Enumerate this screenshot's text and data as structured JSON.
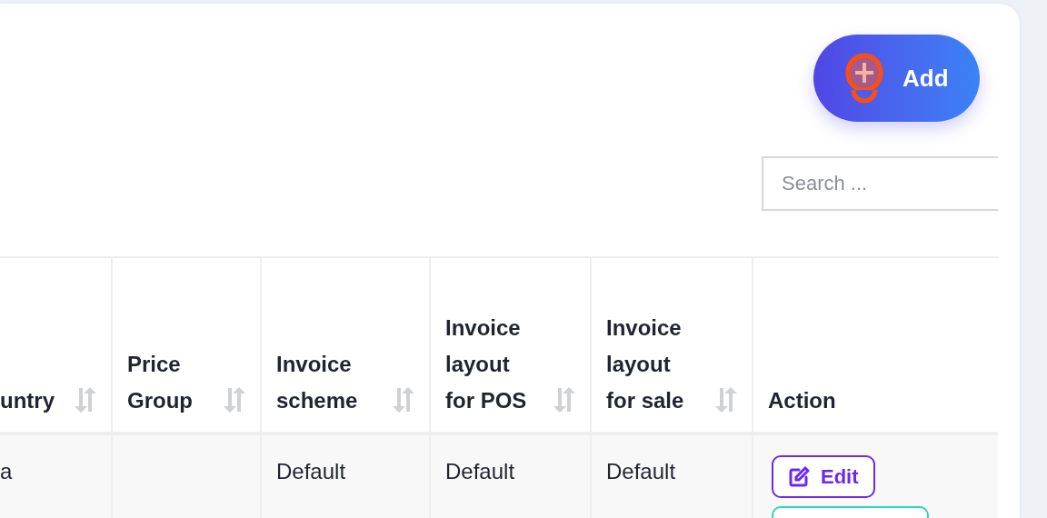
{
  "add_button": {
    "label": "Add"
  },
  "search": {
    "placeholder": "Search ..."
  },
  "table": {
    "columns": [
      {
        "label": "untry",
        "sortable": true
      },
      {
        "label": "Price Group",
        "sortable": true
      },
      {
        "label": "Invoice scheme",
        "sortable": true
      },
      {
        "label": "Invoice layout for POS",
        "sortable": true
      },
      {
        "label": "Invoice layout for sale",
        "sortable": true
      },
      {
        "label": "Action",
        "sortable": false
      }
    ],
    "rows": [
      {
        "cells": [
          "a",
          "",
          "Default",
          "Default",
          "Default"
        ],
        "actions": [
          {
            "kind": "edit",
            "label": "Edit"
          },
          {
            "kind": "cut_off"
          }
        ]
      }
    ]
  }
}
